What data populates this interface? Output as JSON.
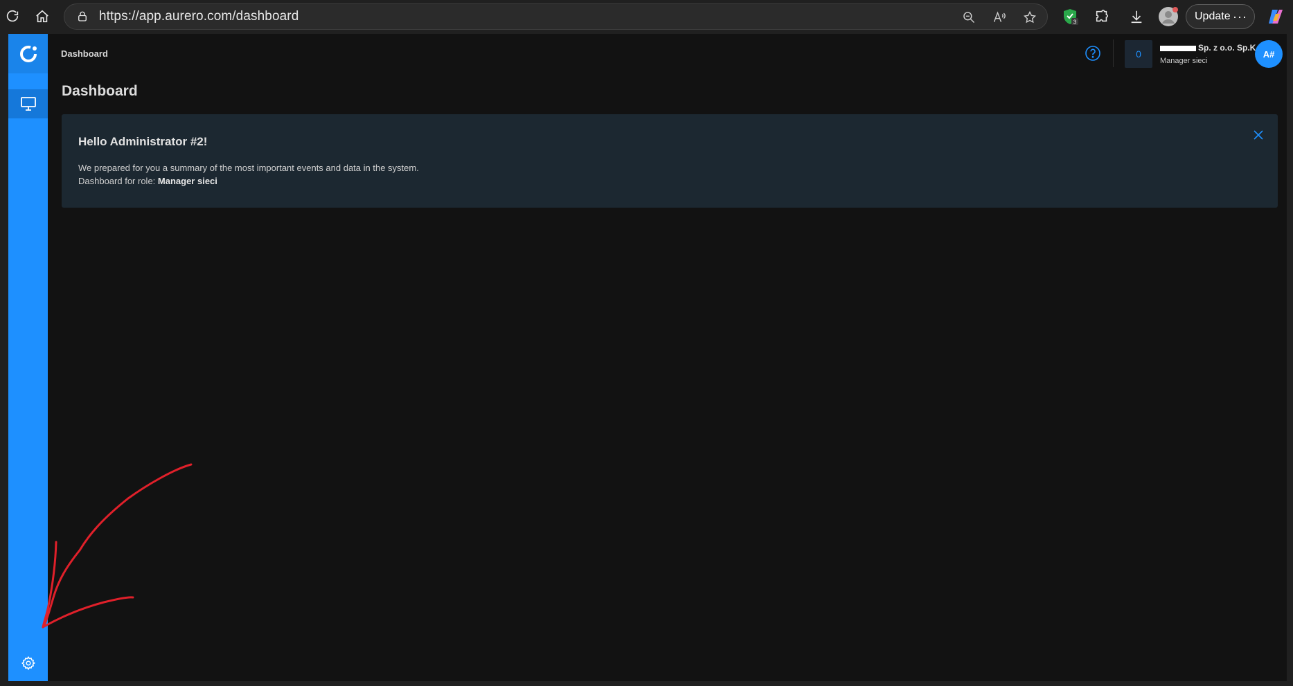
{
  "browser": {
    "url": "https://app.aurero.com/dashboard",
    "update_label": "Update",
    "more_label": "···",
    "extension_badge": "3",
    "icons": [
      "refresh-icon",
      "home-icon",
      "lock-icon",
      "zoom-out-icon",
      "read-aloud-icon",
      "favorite-star-icon",
      "extension-shield-icon",
      "extensions-puzzle-icon",
      "download-icon",
      "profile-icon",
      "copilot-icon"
    ]
  },
  "app": {
    "breadcrumb": "Dashboard",
    "page_title": "Dashboard",
    "notifications_count": "0",
    "company_name": "Sp. z o.o. Sp.K.",
    "company_role": "Manager sieci",
    "avatar_initials": "A#",
    "welcome": {
      "title": "Hello Administrator #2!",
      "line1": "We prepared for you a summary of the most important events and data in the system.",
      "line2_prefix": "Dashboard for role: ",
      "line2_role": "Manager sieci"
    }
  },
  "colors": {
    "accent": "#1e90ff",
    "background": "#121212",
    "card": "#1c2831",
    "annotation": "#e0202a"
  }
}
